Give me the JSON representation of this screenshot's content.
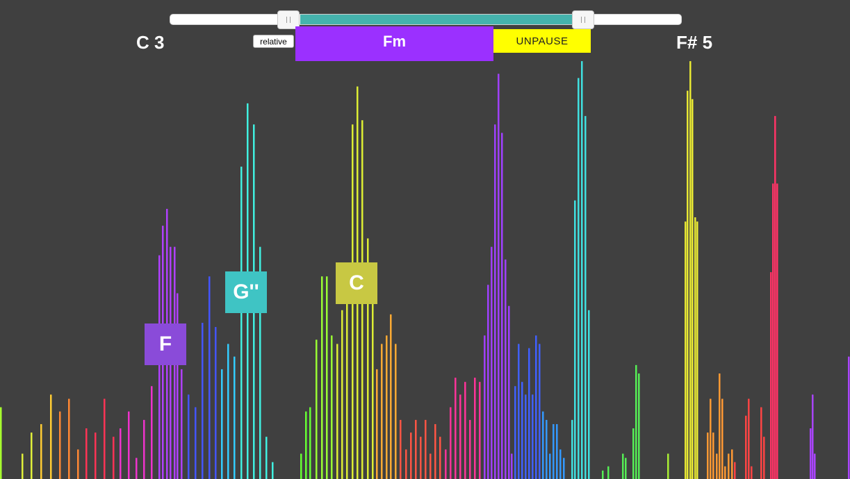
{
  "controls": {
    "low_note": "C 3",
    "high_note": "F# 5",
    "relative_label": "relative",
    "chord": "Fm",
    "unpause_label": "UNPAUSE"
  },
  "colors": {
    "background": "#404040",
    "chord_box": "#9b30ff",
    "unpause": "#ffff00",
    "range_fill": "#45b3ad"
  },
  "peak_labels": [
    {
      "text": "F",
      "color": "#8a4bd9"
    },
    {
      "text": "G''",
      "color": "#3fc4c4"
    },
    {
      "text": "C",
      "color": "#c8c843"
    }
  ],
  "chart_data": {
    "type": "bar",
    "y_range": [
      0,
      1
    ],
    "series": [
      {
        "color": "#a6ff2e",
        "values": [
          [
            0,
            0.17
          ]
        ]
      },
      {
        "color": "#e0f03a",
        "values": [
          [
            31,
            0.06
          ],
          [
            44,
            0.11
          ]
        ]
      },
      {
        "color": "#ffcc33",
        "values": [
          [
            58,
            0.13
          ],
          [
            72,
            0.2
          ]
        ]
      },
      {
        "color": "#ff8833",
        "values": [
          [
            85,
            0.16
          ],
          [
            98,
            0.19
          ],
          [
            111,
            0.07
          ]
        ]
      },
      {
        "color": "#ff3355",
        "values": [
          [
            123,
            0.12
          ],
          [
            136,
            0.11
          ],
          [
            149,
            0.19
          ],
          [
            162,
            0.1
          ]
        ]
      },
      {
        "color": "#ee33cc",
        "values": [
          [
            172,
            0.12
          ],
          [
            184,
            0.16
          ],
          [
            195,
            0.05
          ],
          [
            206,
            0.14
          ],
          [
            217,
            0.22
          ]
        ]
      },
      {
        "color": "#b040ff",
        "values": [
          [
            228,
            0.53
          ],
          [
            233,
            0.6
          ],
          [
            239,
            0.64
          ],
          [
            244,
            0.55
          ],
          [
            250,
            0.55
          ],
          [
            254,
            0.44
          ],
          [
            260,
            0.26
          ]
        ]
      },
      {
        "color": "#4455ff",
        "values": [
          [
            270,
            0.2
          ],
          [
            280,
            0.17
          ],
          [
            290,
            0.37
          ],
          [
            300,
            0.48
          ],
          [
            309,
            0.36
          ]
        ]
      },
      {
        "color": "#33ccff",
        "values": [
          [
            318,
            0.26
          ],
          [
            327,
            0.32
          ],
          [
            336,
            0.29
          ]
        ]
      },
      {
        "color": "#40f0e0",
        "values": [
          [
            346,
            0.74
          ],
          [
            355,
            0.89
          ],
          [
            364,
            0.84
          ],
          [
            373,
            0.55
          ],
          [
            382,
            0.1
          ],
          [
            391,
            0.04
          ]
        ]
      },
      {
        "color": "#66ff33",
        "values": [
          [
            432,
            0.06
          ],
          [
            439,
            0.16
          ],
          [
            445,
            0.17
          ]
        ]
      },
      {
        "color": "#99ff33",
        "values": [
          [
            454,
            0.33
          ],
          [
            462,
            0.48
          ],
          [
            469,
            0.48
          ],
          [
            476,
            0.34
          ]
        ]
      },
      {
        "color": "#ddee33",
        "values": [
          [
            484,
            0.32
          ],
          [
            491,
            0.4
          ],
          [
            498,
            0.42
          ],
          [
            506,
            0.84
          ],
          [
            513,
            0.93
          ],
          [
            520,
            0.85
          ],
          [
            528,
            0.57
          ],
          [
            535,
            0.5
          ]
        ]
      },
      {
        "color": "#ffaa33",
        "values": [
          [
            541,
            0.26
          ],
          [
            548,
            0.32
          ],
          [
            555,
            0.34
          ],
          [
            561,
            0.39
          ],
          [
            568,
            0.32
          ]
        ]
      },
      {
        "color": "#ff5544",
        "values": [
          [
            575,
            0.14
          ],
          [
            583,
            0.07
          ],
          [
            590,
            0.11
          ],
          [
            597,
            0.14
          ],
          [
            604,
            0.1
          ],
          [
            611,
            0.14
          ],
          [
            618,
            0.06
          ],
          [
            625,
            0.13
          ],
          [
            632,
            0.1
          ]
        ]
      },
      {
        "color": "#ff3399",
        "values": [
          [
            640,
            0.07
          ],
          [
            647,
            0.17
          ],
          [
            654,
            0.24
          ],
          [
            661,
            0.2
          ],
          [
            668,
            0.23
          ],
          [
            675,
            0.14
          ],
          [
            682,
            0.24
          ],
          [
            689,
            0.23
          ]
        ]
      },
      {
        "color": "#a040ff",
        "values": [
          [
            696,
            0.34
          ],
          [
            701,
            0.46
          ],
          [
            706,
            0.55
          ],
          [
            711,
            0.84
          ],
          [
            716,
            0.96
          ],
          [
            721,
            0.82
          ],
          [
            726,
            0.52
          ],
          [
            731,
            0.41
          ],
          [
            735,
            0.06
          ]
        ]
      },
      {
        "color": "#4060ff",
        "values": [
          [
            740,
            0.22
          ],
          [
            745,
            0.32
          ],
          [
            750,
            0.23
          ],
          [
            755,
            0.2
          ],
          [
            760,
            0.31
          ],
          [
            765,
            0.2
          ],
          [
            770,
            0.34
          ],
          [
            775,
            0.32
          ]
        ]
      },
      {
        "color": "#3399ff",
        "values": [
          [
            780,
            0.16
          ],
          [
            785,
            0.14
          ],
          [
            790,
            0.06
          ],
          [
            795,
            0.13
          ],
          [
            800,
            0.13
          ],
          [
            805,
            0.07
          ],
          [
            810,
            0.05
          ]
        ]
      },
      {
        "color": "#40e0e0",
        "values": [
          [
            822,
            0.14
          ],
          [
            826,
            0.66
          ],
          [
            831,
            0.95
          ],
          [
            836,
            0.99
          ],
          [
            841,
            0.86
          ],
          [
            846,
            0.4
          ]
        ]
      },
      {
        "color": "#55ee55",
        "values": [
          [
            866,
            0.02
          ],
          [
            874,
            0.03
          ],
          [
            895,
            0.06
          ],
          [
            899,
            0.05
          ],
          [
            910,
            0.12
          ],
          [
            914,
            0.27
          ],
          [
            918,
            0.25
          ]
        ]
      },
      {
        "color": "#aaee33",
        "values": [
          [
            960,
            0.06
          ]
        ]
      },
      {
        "color": "#e8e833",
        "values": [
          [
            985,
            0.61
          ],
          [
            988,
            0.92
          ],
          [
            992,
            0.99
          ],
          [
            995,
            0.9
          ],
          [
            999,
            0.62
          ],
          [
            1002,
            0.61
          ]
        ]
      },
      {
        "color": "#ff9933",
        "values": [
          [
            1017,
            0.11
          ],
          [
            1021,
            0.19
          ],
          [
            1025,
            0.11
          ],
          [
            1030,
            0.06
          ],
          [
            1034,
            0.25
          ],
          [
            1038,
            0.19
          ],
          [
            1042,
            0.03
          ],
          [
            1047,
            0.06
          ],
          [
            1052,
            0.07
          ]
        ]
      },
      {
        "color": "#ff4444",
        "values": [
          [
            1056,
            0.04
          ],
          [
            1072,
            0.15
          ],
          [
            1076,
            0.19
          ],
          [
            1080,
            0.03
          ],
          [
            1094,
            0.17
          ],
          [
            1098,
            0.1
          ]
        ]
      },
      {
        "color": "#ff3366",
        "values": [
          [
            1108,
            0.49
          ],
          [
            1111,
            0.7
          ],
          [
            1114,
            0.86
          ],
          [
            1117,
            0.7
          ]
        ]
      },
      {
        "color": "#aa44ff",
        "values": [
          [
            1165,
            0.12
          ],
          [
            1168,
            0.2
          ],
          [
            1171,
            0.06
          ],
          [
            1220,
            0.29
          ]
        ]
      }
    ]
  }
}
